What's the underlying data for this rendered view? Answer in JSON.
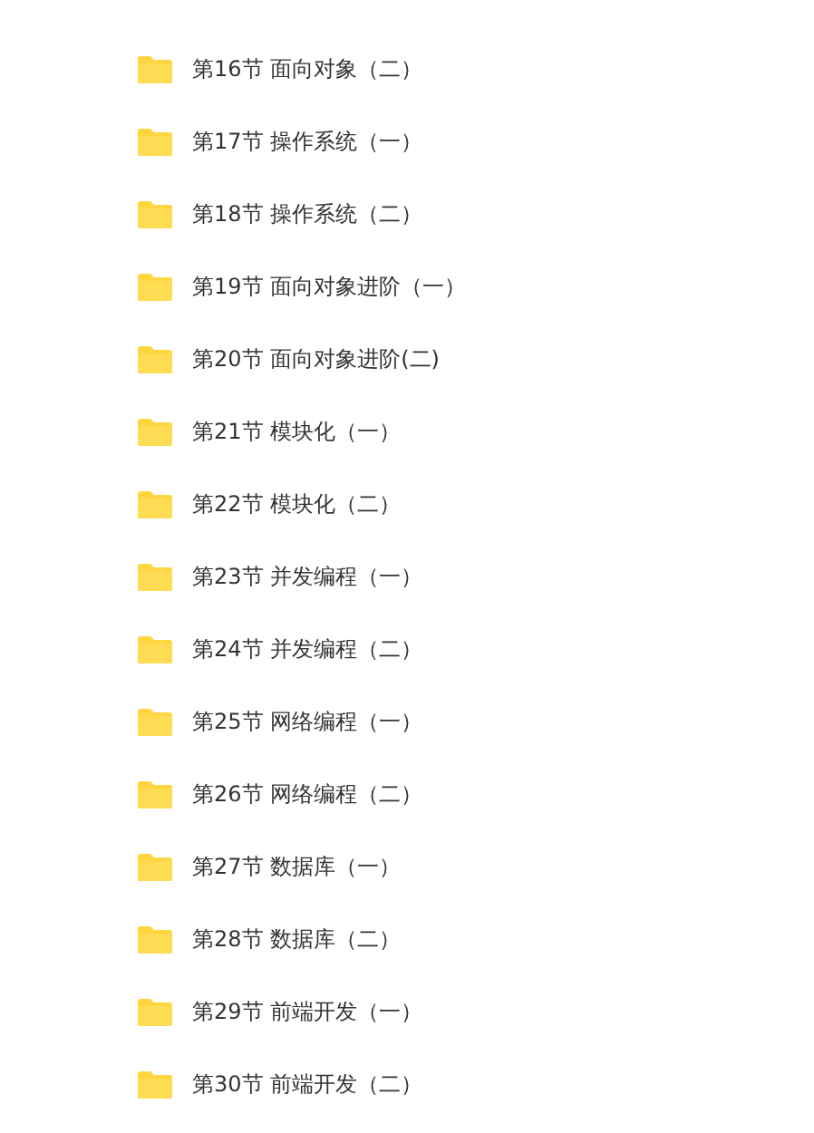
{
  "folders": [
    {
      "name": "第16节 面向对象（二）"
    },
    {
      "name": "第17节 操作系统（一）"
    },
    {
      "name": "第18节 操作系统（二）"
    },
    {
      "name": "第19节 面向对象进阶（一）"
    },
    {
      "name": "第20节 面向对象进阶(二)"
    },
    {
      "name": "第21节 模块化（一）"
    },
    {
      "name": "第22节 模块化（二）"
    },
    {
      "name": "第23节 并发编程（一）"
    },
    {
      "name": "第24节 并发编程（二）"
    },
    {
      "name": "第25节 网络编程（一）"
    },
    {
      "name": "第26节 网络编程（二）"
    },
    {
      "name": "第27节 数据库（一）"
    },
    {
      "name": "第28节 数据库（二）"
    },
    {
      "name": "第29节 前端开发（一）"
    },
    {
      "name": "第30节 前端开发（二）"
    }
  ]
}
